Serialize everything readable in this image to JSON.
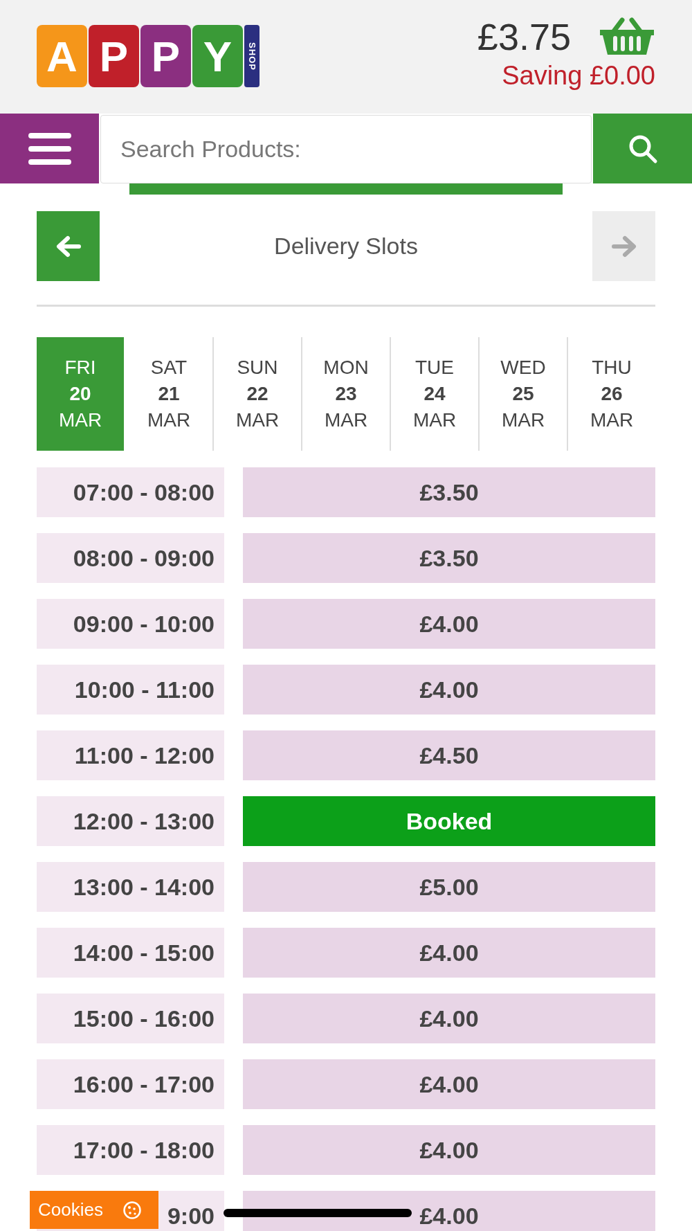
{
  "header": {
    "logo": {
      "letters": [
        {
          "text": "A",
          "color": "#f5961a"
        },
        {
          "text": "P",
          "color": "#c0202a"
        },
        {
          "text": "P",
          "color": "#8b2f80"
        },
        {
          "text": "Y",
          "color": "#3a9a37"
        }
      ],
      "tag": "SHOP"
    },
    "total": "£3.75",
    "saving": "Saving £0.00"
  },
  "search": {
    "placeholder": "Search Products:"
  },
  "slots_header": {
    "title": "Delivery Slots",
    "prev_disabled": false,
    "next_disabled": true
  },
  "days": [
    {
      "weekday": "FRI",
      "day": "20",
      "month": "MAR",
      "selected": true
    },
    {
      "weekday": "SAT",
      "day": "21",
      "month": "MAR",
      "selected": false
    },
    {
      "weekday": "SUN",
      "day": "22",
      "month": "MAR",
      "selected": false
    },
    {
      "weekday": "MON",
      "day": "23",
      "month": "MAR",
      "selected": false
    },
    {
      "weekday": "TUE",
      "day": "24",
      "month": "MAR",
      "selected": false
    },
    {
      "weekday": "WED",
      "day": "25",
      "month": "MAR",
      "selected": false
    },
    {
      "weekday": "THU",
      "day": "26",
      "month": "MAR",
      "selected": false
    }
  ],
  "slots": [
    {
      "time": "07:00 - 08:00",
      "kind": "price",
      "label": "£3.50"
    },
    {
      "time": "08:00 - 09:00",
      "kind": "price",
      "label": "£3.50"
    },
    {
      "time": "09:00 - 10:00",
      "kind": "price",
      "label": "£4.00"
    },
    {
      "time": "10:00 - 11:00",
      "kind": "price",
      "label": "£4.00"
    },
    {
      "time": "11:00 - 12:00",
      "kind": "price",
      "label": "£4.50"
    },
    {
      "time": "12:00 - 13:00",
      "kind": "booked",
      "label": "Booked"
    },
    {
      "time": "13:00 - 14:00",
      "kind": "price",
      "label": "£5.00"
    },
    {
      "time": "14:00 - 15:00",
      "kind": "price",
      "label": "£4.00"
    },
    {
      "time": "15:00 - 16:00",
      "kind": "price",
      "label": "£4.00"
    },
    {
      "time": "16:00 - 17:00",
      "kind": "price",
      "label": "£4.00"
    },
    {
      "time": "17:00 - 18:00",
      "kind": "price",
      "label": "£4.00"
    },
    {
      "time": "9:00",
      "kind": "price",
      "label": "£4.00"
    }
  ],
  "cookies": {
    "label": "Cookies"
  }
}
